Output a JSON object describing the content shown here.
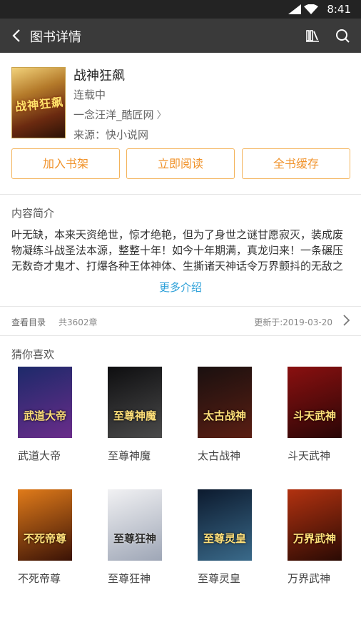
{
  "status_bar": {
    "time": "8:41"
  },
  "app_bar": {
    "title": "图书详情"
  },
  "book": {
    "cover_text": "战神狂飙",
    "title": "战神狂飙",
    "status": "连载中",
    "author": "一念汪洋_酷匠网",
    "source": "来源：快小说网"
  },
  "actions": {
    "add_shelf": "加入书架",
    "read_now": "立即阅读",
    "cache_all": "全书缓存"
  },
  "summary": {
    "heading": "内容简介",
    "text": "叶无缺，本来天资绝世，惊才绝艳，但为了身世之谜甘愿寂灭，装成废物凝练斗战圣法本源，整整十年！如今十年期满，真龙归来！一条碾压无数奇才鬼才、打爆各种王体神体、生撕诸天神话令万界颤抖的无敌之",
    "more": "更多介绍"
  },
  "toc": {
    "label": "查看目录",
    "count": "共3602章",
    "updated": "更新于:2019-03-20"
  },
  "recommend": {
    "heading": "猜你喜欢",
    "books": [
      {
        "title": "武道大帝",
        "cover_text": "武道大帝",
        "color_a": "#1d2a6a",
        "color_b": "#6a2c8a"
      },
      {
        "title": "至尊神魔",
        "cover_text": "至尊神魔",
        "color_a": "#0e0e10",
        "color_b": "#4a4a4a"
      },
      {
        "title": "太古战神",
        "cover_text": "太古战神",
        "color_a": "#1a1010",
        "color_b": "#5a1e12"
      },
      {
        "title": "斗天武神",
        "cover_text": "斗天武神",
        "color_a": "#8a1010",
        "color_b": "#2a0606"
      },
      {
        "title": "不死帝尊",
        "cover_text": "不死帝尊",
        "color_a": "#e07b1a",
        "color_b": "#3a1206"
      },
      {
        "title": "至尊狂神",
        "cover_text": "至尊狂神",
        "color_a": "#f1f1f3",
        "color_b": "#9ea6b6"
      },
      {
        "title": "至尊灵皇",
        "cover_text": "至尊灵皇",
        "color_a": "#0c1a2e",
        "color_b": "#3a6a8a"
      },
      {
        "title": "万界武神",
        "cover_text": "万界武神",
        "color_a": "#b23210",
        "color_b": "#2a0a04"
      }
    ]
  },
  "colors": {
    "accent": "#f0922a",
    "link": "#2a9fd8",
    "appbar": "#3a3a3a"
  }
}
